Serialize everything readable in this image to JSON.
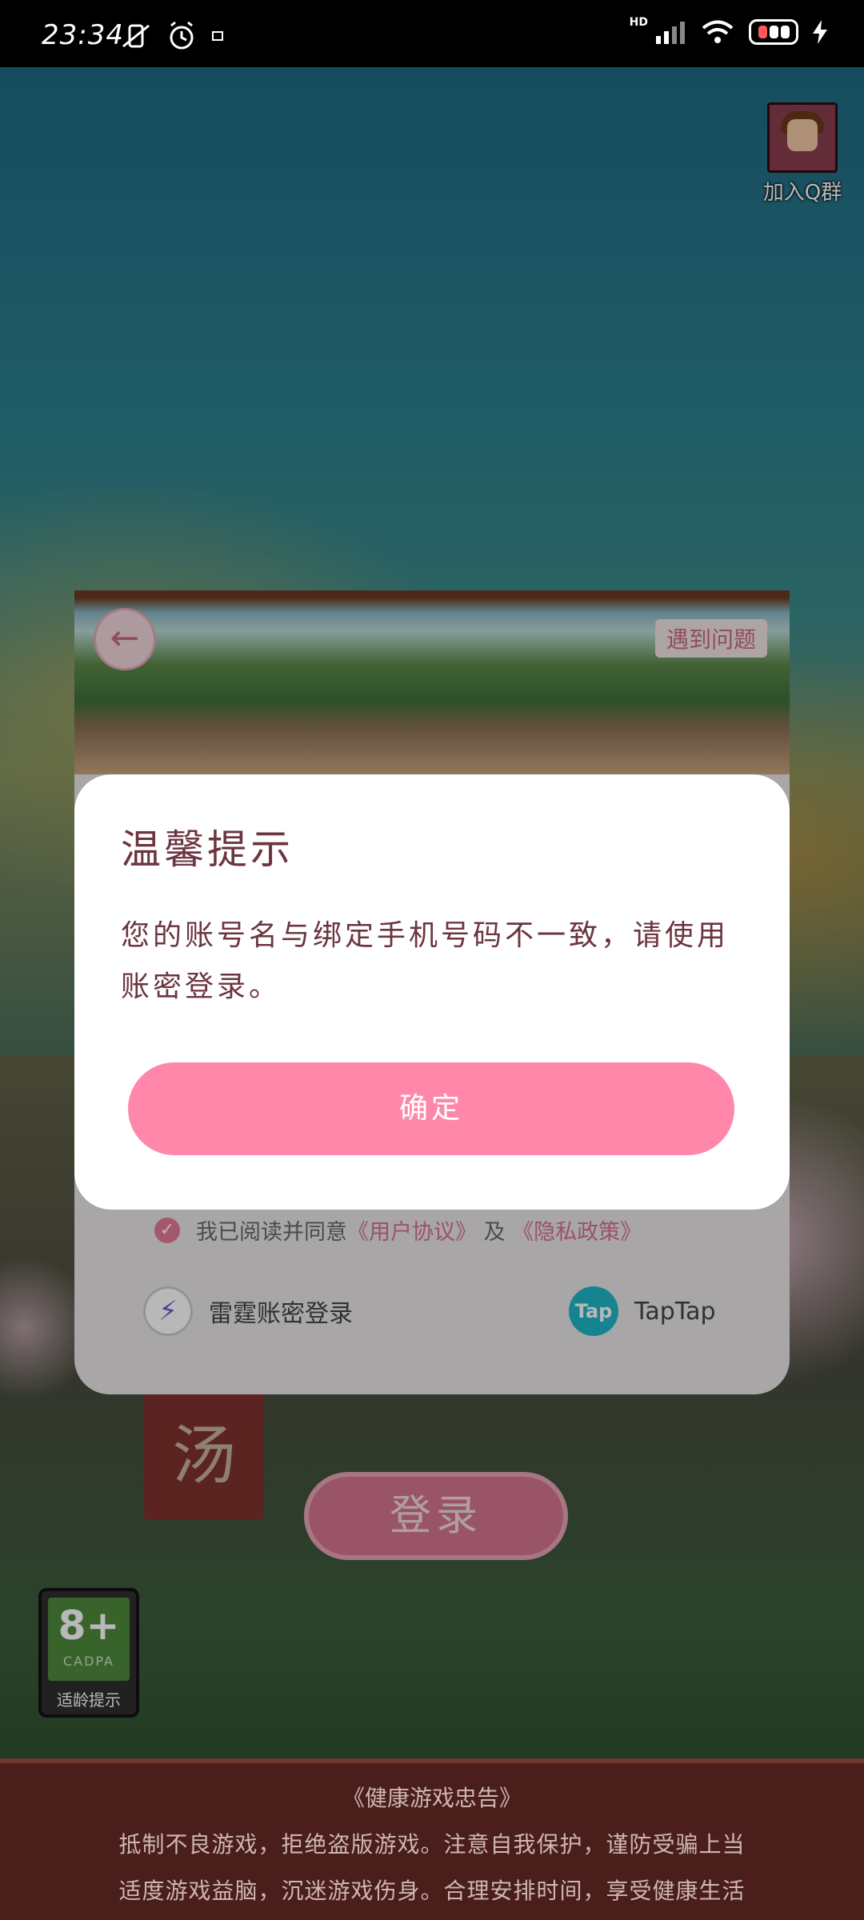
{
  "status_bar": {
    "time": "23:34",
    "network": "HD",
    "icons": [
      "mute-vibrate-icon",
      "alarm-icon",
      "notification-icon",
      "signal-icon",
      "wifi-icon",
      "battery-icon",
      "charging-icon"
    ]
  },
  "qq_group": {
    "label": "加入Q群"
  },
  "login_panel": {
    "problem_button": "遇到问题",
    "agree_text_prefix": "我已阅读并同意",
    "user_agreement": "《用户协议》",
    "agree_and": "及",
    "privacy_policy": "《隐私政策》",
    "leidian_login": "雷霆账密登录",
    "taptap_icon_text": "Tap",
    "taptap_label": "TapTap"
  },
  "background": {
    "banner_char": "汤",
    "login_button": "登录"
  },
  "age_rating": {
    "number": "8+",
    "org": "CADPA",
    "label": "适龄提示"
  },
  "dialog": {
    "title": "温馨提示",
    "message": "您的账号名与绑定手机号码不一致，请使用账密登录。",
    "confirm_button": "确定"
  },
  "health_notice": {
    "title": "《健康游戏忠告》",
    "line1": "抵制不良游戏，拒绝盗版游戏。注意自我保护，谨防受骗上当",
    "line2": "适度游戏益脑，沉迷游戏伤身。合理安排时间，享受健康生活"
  },
  "colors": {
    "accent": "#ff88aa",
    "dialog_text": "#6b3540",
    "notice_bg": "#4a1e1a"
  }
}
